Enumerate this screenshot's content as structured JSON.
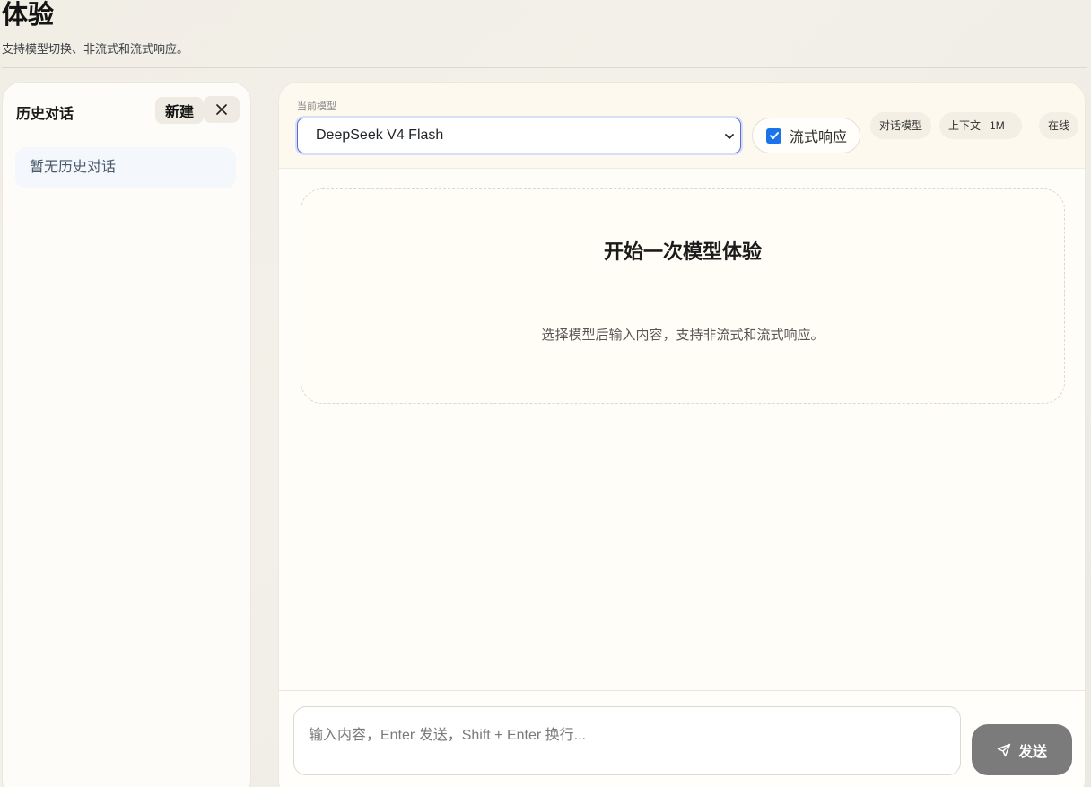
{
  "header": {
    "title": "体验",
    "subtitle": "支持模型切换、非流式和流式响应。"
  },
  "sidebar": {
    "title": "历史对话",
    "new_label": "新建",
    "empty_text": "暂无历史对话"
  },
  "toolbar": {
    "model_label": "当前模型",
    "selected_model": "DeepSeek V4 Flash",
    "stream_label": "流式响应",
    "stream_enabled": true,
    "chips": {
      "type": "对话模型",
      "context_label": "上下文",
      "context_value": "1M",
      "status": "在线"
    }
  },
  "welcome": {
    "title": "开始一次模型体验",
    "description": "选择模型后输入内容，支持非流式和流式响应。"
  },
  "composer": {
    "placeholder": "输入内容，Enter 发送，Shift + Enter 换行...",
    "send_label": "发送"
  },
  "colors": {
    "accent": "#1a73e8",
    "select_border": "#5a6bd8",
    "send_button": "#7b7b7b"
  },
  "icons": {
    "close": "close-icon",
    "chevron": "chevron-down-icon",
    "check": "check-icon",
    "send": "send-icon"
  }
}
